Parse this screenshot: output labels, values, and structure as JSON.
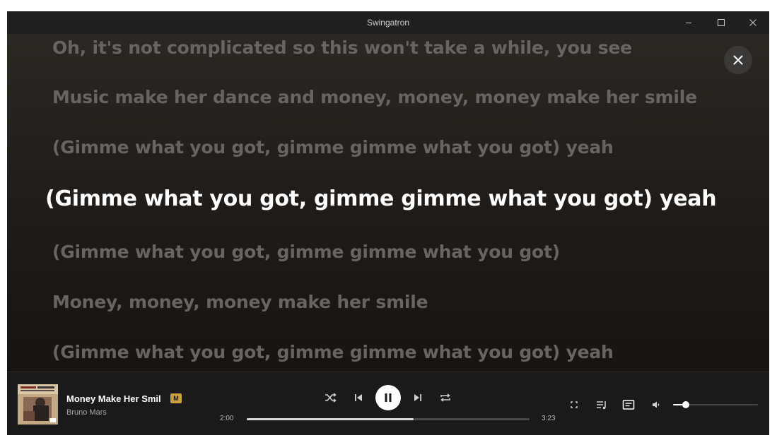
{
  "window": {
    "title": "Swingatron"
  },
  "lyrics": {
    "lines": [
      "Oh, it's not complicated so this won't take a while, you see",
      "Music make her dance and money, money, money make her smile",
      "(Gimme what you got, gimme gimme what you got) yeah",
      "(Gimme what you got, gimme gimme what you got) yeah",
      "(Gimme what you got, gimme gimme what you got)",
      "Money, money, money make her smile",
      "(Gimme what you got, gimme gimme what you got) yeah"
    ],
    "active_index": 3
  },
  "now_playing": {
    "title": "Money Make Her Smil",
    "badge": "M",
    "artist": "Bruno Mars",
    "elapsed": "2:00",
    "duration": "3:23",
    "progress_fraction": 0.59,
    "volume_fraction": 0.15,
    "is_playing": true
  },
  "icons": {
    "minimize": "minimize-icon",
    "maximize": "maximize-icon",
    "close": "close-icon",
    "shuffle": "shuffle-icon",
    "previous": "previous-icon",
    "pause": "pause-icon",
    "next": "next-icon",
    "repeat": "repeat-icon",
    "fullscreen": "fullscreen-icon",
    "queue": "queue-icon",
    "lyrics": "lyrics-icon",
    "volume": "volume-icon"
  },
  "colors": {
    "accent_badge": "#c9a13a",
    "active_lyric": "#ffffff",
    "inactive_lyric": "#676461",
    "player_bg": "#1a1a1a"
  }
}
